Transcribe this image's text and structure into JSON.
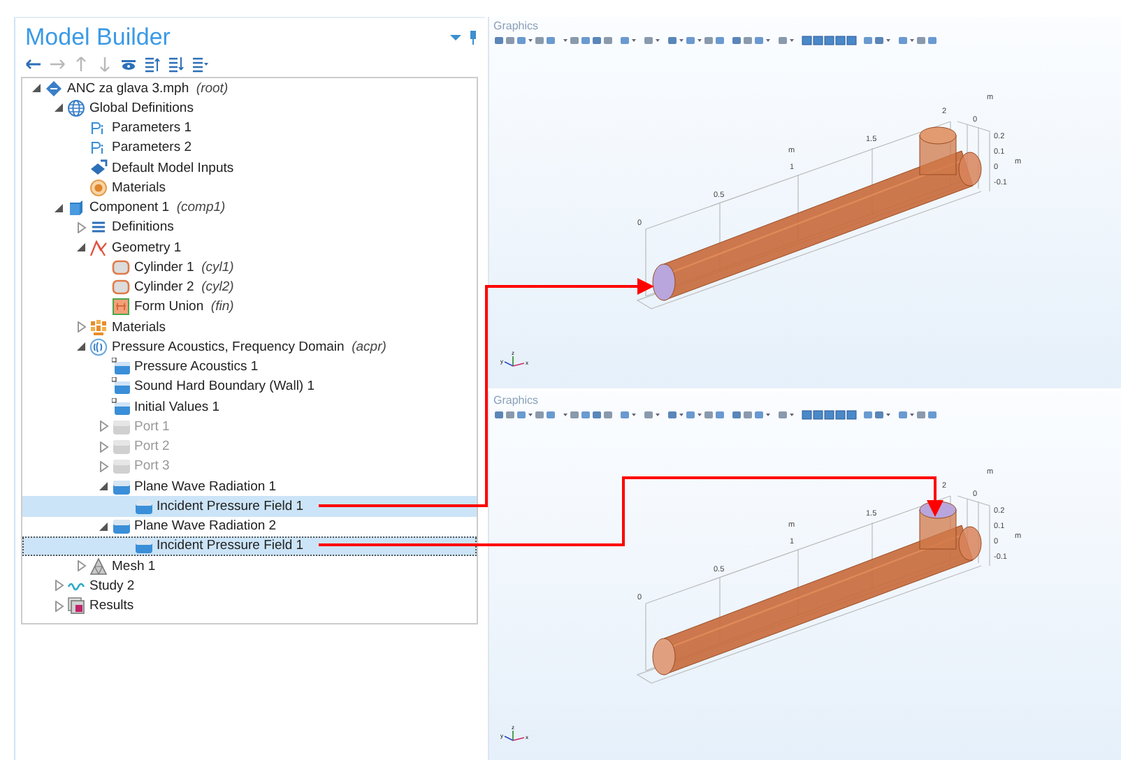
{
  "panel": {
    "title": "Model Builder"
  },
  "toolbar": [
    {
      "kind": "back",
      "disabled": false
    },
    {
      "kind": "forward",
      "disabled": true
    },
    {
      "kind": "up",
      "disabled": true
    },
    {
      "kind": "down",
      "disabled": true
    },
    {
      "kind": "show",
      "disabled": false
    },
    {
      "kind": "collapse",
      "disabled": false
    },
    {
      "kind": "expand",
      "disabled": false
    },
    {
      "kind": "layout",
      "disabled": false
    }
  ],
  "tree": [
    {
      "label": "ANC za glava 3.mph",
      "tag": "(root)",
      "kind": "root",
      "expanded": true,
      "selected": false,
      "disabled": false,
      "children": [
        {
          "label": "Global Definitions",
          "kind": "globe",
          "expanded": true,
          "selected": false,
          "disabled": false,
          "children": [
            {
              "label": "Parameters 1",
              "kind": "param",
              "selected": false,
              "disabled": false
            },
            {
              "label": "Parameters 2",
              "kind": "param",
              "selected": false,
              "disabled": false
            },
            {
              "label": "Default Model Inputs",
              "kind": "inputs",
              "selected": false,
              "disabled": false
            },
            {
              "label": "Materials",
              "kind": "material",
              "selected": false,
              "disabled": false
            }
          ]
        },
        {
          "label": "Component 1",
          "tag": "(comp1)",
          "kind": "component",
          "expanded": true,
          "selected": false,
          "disabled": false,
          "children": [
            {
              "label": "Definitions",
              "kind": "definitions",
              "expanded": false,
              "selected": false,
              "disabled": false
            },
            {
              "label": "Geometry 1",
              "kind": "geometry",
              "expanded": true,
              "selected": false,
              "disabled": false,
              "children": [
                {
                  "label": "Cylinder 1",
                  "tag": "(cyl1)",
                  "kind": "cylinder",
                  "selected": false,
                  "disabled": false
                },
                {
                  "label": "Cylinder 2",
                  "tag": "(cyl2)",
                  "kind": "cylinder",
                  "selected": false,
                  "disabled": false
                },
                {
                  "label": "Form Union",
                  "tag": "(fin)",
                  "kind": "union",
                  "selected": false,
                  "disabled": false
                }
              ]
            },
            {
              "label": "Materials",
              "kind": "materials",
              "expanded": false,
              "selected": false,
              "disabled": false
            },
            {
              "label": "Pressure Acoustics, Frequency Domain",
              "tag": "(acpr)",
              "kind": "physics",
              "expanded": true,
              "selected": false,
              "disabled": false,
              "children": [
                {
                  "label": "Pressure Acoustics 1",
                  "kind": "domain",
                  "selected": false,
                  "disabled": false
                },
                {
                  "label": "Sound Hard Boundary (Wall) 1",
                  "kind": "domain",
                  "selected": false,
                  "disabled": false
                },
                {
                  "label": "Initial Values 1",
                  "kind": "domain",
                  "selected": false,
                  "disabled": false
                },
                {
                  "label": "Port 1",
                  "kind": "boundary",
                  "expanded": false,
                  "selected": false,
                  "disabled": true
                },
                {
                  "label": "Port 2",
                  "kind": "boundary",
                  "expanded": false,
                  "selected": false,
                  "disabled": true
                },
                {
                  "label": "Port 3",
                  "kind": "boundary",
                  "expanded": false,
                  "selected": false,
                  "disabled": true
                },
                {
                  "label": "Plane Wave Radiation 1",
                  "kind": "boundary",
                  "expanded": true,
                  "selected": false,
                  "disabled": false,
                  "children": [
                    {
                      "label": "Incident Pressure Field 1",
                      "kind": "boundary",
                      "selected": true,
                      "focused": false,
                      "disabled": false
                    }
                  ]
                },
                {
                  "label": "Plane Wave Radiation 2",
                  "kind": "boundary",
                  "expanded": true,
                  "selected": false,
                  "disabled": false,
                  "children": [
                    {
                      "label": "Incident Pressure Field 1",
                      "kind": "boundary",
                      "selected": true,
                      "focused": true,
                      "disabled": false
                    }
                  ]
                }
              ]
            },
            {
              "label": "Mesh 1",
              "kind": "mesh",
              "expanded": false,
              "selected": false,
              "disabled": false
            }
          ]
        },
        {
          "label": "Study 2",
          "kind": "study",
          "expanded": false,
          "selected": false,
          "disabled": false
        },
        {
          "label": "Results",
          "kind": "results",
          "expanded": false,
          "selected": false,
          "disabled": false
        }
      ]
    }
  ],
  "graphics": [
    {
      "title": "Graphics",
      "kind": "end-face",
      "axis_x": {
        "unit": "m",
        "ticks": [
          "0",
          "0.5",
          "1",
          "1.5",
          "2"
        ]
      },
      "axis_y": {
        "unit": "m",
        "ticks": [
          "0"
        ]
      },
      "axis_z": {
        "unit": "m",
        "ticks": [
          "0.2",
          "0.1",
          "0",
          "-0.1"
        ]
      },
      "triad": [
        "z",
        "y",
        "x"
      ]
    },
    {
      "title": "Graphics",
      "kind": "top-face",
      "axis_x": {
        "unit": "m",
        "ticks": [
          "0",
          "0.5",
          "1",
          "1.5",
          "2"
        ]
      },
      "axis_y": {
        "unit": "m",
        "ticks": [
          "0"
        ]
      },
      "axis_z": {
        "unit": "m",
        "ticks": [
          "0.2",
          "0.1",
          "0",
          "-0.1"
        ]
      },
      "triad": [
        "z",
        "y",
        "x"
      ]
    }
  ]
}
